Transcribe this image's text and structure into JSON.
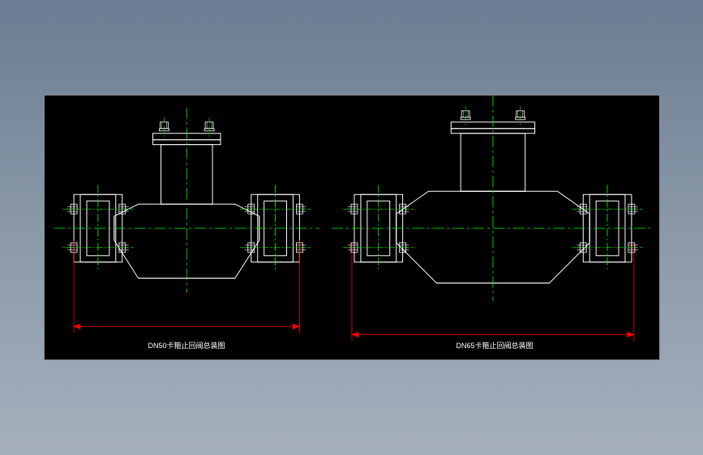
{
  "captions": {
    "left_drawing": "DN50卡箍止回阀总装图",
    "right_drawing": "DN65卡箍止回阀总装图"
  },
  "colors": {
    "background_frame": "#000000",
    "line_white": "#ffffff",
    "centerline_green": "#00ff00",
    "dimension_red": "#ff0000",
    "caption": "#ffffff"
  },
  "drawing": {
    "type": "cad-assembly",
    "views": [
      {
        "id": "left",
        "title_key": "captions.left_drawing",
        "nominal_size": "DN50"
      },
      {
        "id": "right",
        "title_key": "captions.right_drawing",
        "nominal_size": "DN65"
      }
    ]
  }
}
